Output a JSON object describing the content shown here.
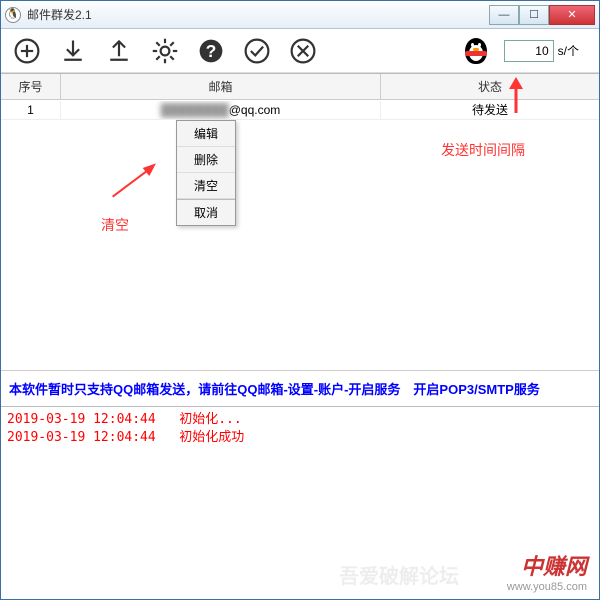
{
  "window": {
    "title": "邮件群发2.1"
  },
  "toolbar": {
    "interval_value": "10",
    "interval_unit": "s/个"
  },
  "table": {
    "headers": {
      "seq": "序号",
      "email": "邮箱",
      "status": "状态"
    },
    "rows": [
      {
        "seq": "1",
        "email": "@qq.com",
        "status": "待发送"
      }
    ]
  },
  "context_menu": {
    "edit": "编辑",
    "delete": "删除",
    "clear": "清空",
    "cancel": "取消"
  },
  "annotations": {
    "clear_label": "清空",
    "interval_label": "发送时间间隔"
  },
  "notice": "本软件暂时只支持QQ邮箱发送，请前往QQ邮箱-设置-账户-开启服务　开启POP3/SMTP服务",
  "log": [
    {
      "ts": "2019-03-19 12:04:44",
      "msg": "初始化..."
    },
    {
      "ts": "2019-03-19 12:04:44",
      "msg": "初始化成功"
    }
  ],
  "watermarks": {
    "left": "吾爱破解论坛",
    "brand": "中赚网",
    "url": "www.you85.com"
  }
}
